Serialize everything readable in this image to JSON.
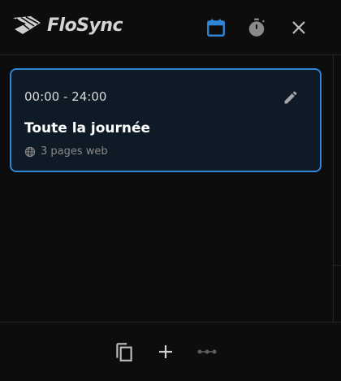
{
  "app": {
    "name": "FloSync"
  },
  "header": {
    "icons": [
      "calendar-icon",
      "timer-icon",
      "close-icon"
    ],
    "active_icon": "calendar-icon",
    "accent_color": "#2f86d6"
  },
  "schedule": {
    "items": [
      {
        "time": "00:00 - 24:00",
        "title": "Toute la journée",
        "meta": "3 pages web",
        "meta_icon": "globe-icon",
        "action_icon": "edit-icon",
        "selected": true
      }
    ]
  },
  "footer": {
    "icons": [
      "copy-icon",
      "add-icon",
      "more-icon"
    ]
  }
}
